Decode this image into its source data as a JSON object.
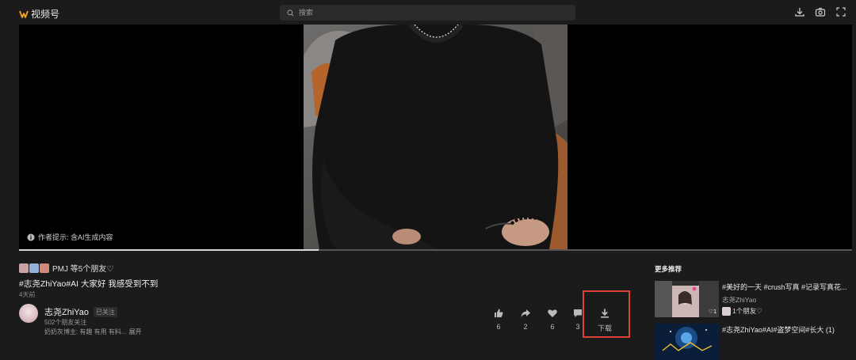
{
  "app": {
    "title": "视频号"
  },
  "search": {
    "placeholder": "搜索"
  },
  "player": {
    "ai_hint": "作者提示: 含AI生成内容",
    "progress": 0.36
  },
  "post": {
    "friends_text": "PMJ 等5个朋友♡",
    "title": "#志尧ZhiYao#AI 大家好 我感受到不到",
    "posted": "4天前",
    "author": {
      "name": "志尧ZhiYao",
      "follow_status": "已关注",
      "friends_following": "502个朋友关注",
      "desc": "奶奶灰博主: 有趣 有用 有料...",
      "expand": "展开"
    }
  },
  "actions": {
    "like_count": "6",
    "share_count": "2",
    "heart_count": "6",
    "comment_count": "3",
    "download_label": "下载"
  },
  "recommendations": {
    "heading": "更多推荐",
    "items": [
      {
        "title": "#美好的一天 #crush写真 #记录写真花...",
        "author": "志尧ZhiYao",
        "friends": "1个朋友♡",
        "likes": "♡1"
      },
      {
        "title": "#志尧ZhiYao#AI#盗梦空间#长大 (1)",
        "author": "",
        "friends": "",
        "likes": ""
      }
    ]
  },
  "colors": {
    "accent_logo": "#f5a623",
    "highlight_box": "#e0413a"
  },
  "icons": [
    "logo-icon",
    "search-icon",
    "download-icon",
    "camera-icon",
    "info-icon",
    "thumbs-up-icon",
    "share-icon",
    "heart-icon",
    "comment-icon"
  ]
}
